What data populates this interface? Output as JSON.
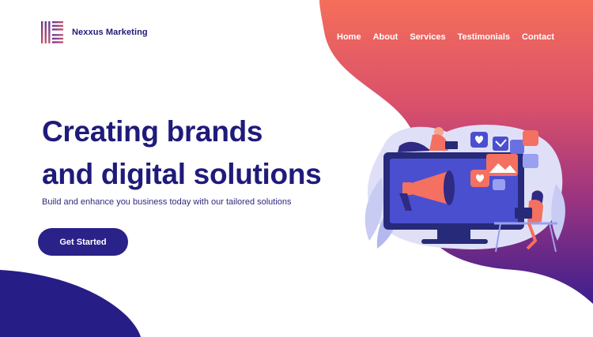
{
  "brand": {
    "name": "Nexxus Marketing",
    "logo_icon": "striped-square-logo"
  },
  "nav": {
    "items": [
      {
        "label": "Home"
      },
      {
        "label": "About"
      },
      {
        "label": "Services"
      },
      {
        "label": "Testimonials"
      },
      {
        "label": "Contact"
      }
    ]
  },
  "hero": {
    "title_line1": "Creating brands",
    "title_line2": "and digital solutions",
    "subtitle": "Build and enhance you business today with our tailored solutions",
    "cta_label": "Get Started"
  },
  "illustration": {
    "icon": "megaphone-monitor-illustration"
  },
  "colors": {
    "navy": "#1f1b7a",
    "button": "#2a2189",
    "gradient_top": "#f26a5c",
    "gradient_mid": "#a0357e",
    "gradient_bottom": "#3e1d8c"
  }
}
